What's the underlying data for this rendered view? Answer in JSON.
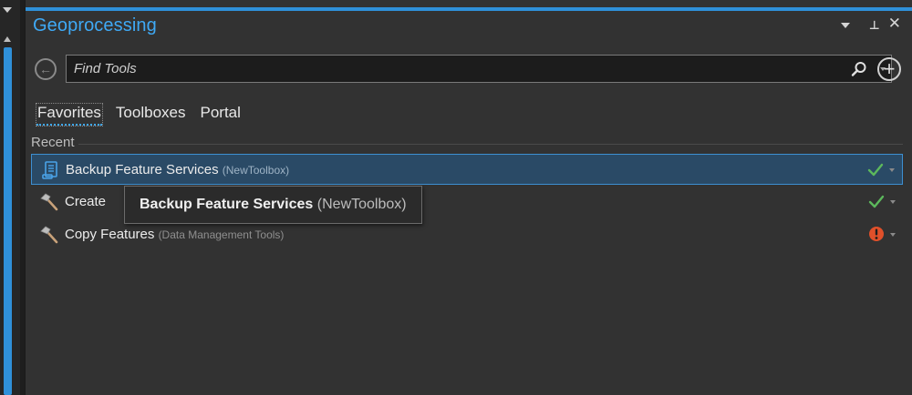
{
  "pane": {
    "title": "Geoprocessing"
  },
  "search": {
    "placeholder": "Find Tools"
  },
  "tabs": [
    {
      "label": "Favorites",
      "active": true
    },
    {
      "label": "Toolboxes",
      "active": false
    },
    {
      "label": "Portal",
      "active": false
    }
  ],
  "recent": {
    "label": "Recent",
    "items": [
      {
        "name": "Backup Feature Services",
        "source": "(NewToolbox)",
        "icon": "script-tool-icon",
        "status": "success",
        "selected": true
      },
      {
        "name": "Create",
        "source": "",
        "icon": "hammer-icon",
        "status": "success",
        "selected": false
      },
      {
        "name": "Copy Features",
        "source": "(Data Management Tools)",
        "icon": "hammer-icon",
        "status": "error",
        "selected": false
      }
    ]
  },
  "tooltip": {
    "name": "Backup Feature Services",
    "source": "(NewToolbox)"
  },
  "colors": {
    "accent": "#2f90d9",
    "title": "#3fa9f5",
    "success": "#5cb85c",
    "error": "#e0502a",
    "selection": "#2a4a66"
  }
}
